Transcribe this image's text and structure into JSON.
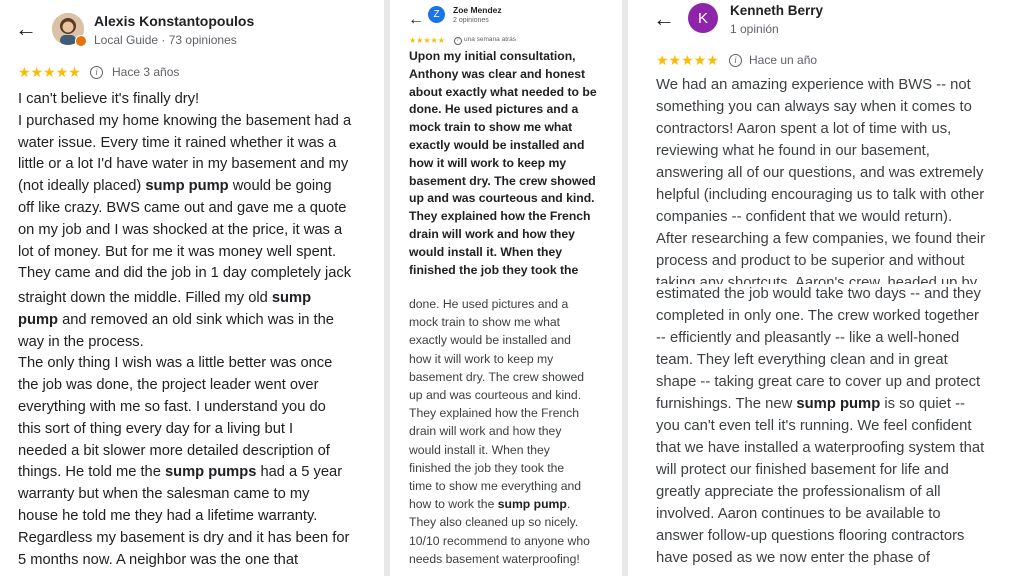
{
  "colors": {
    "star": "#fbbc04",
    "avatar_zoe": "#1a73e8",
    "avatar_kenneth": "#8e24aa",
    "text": "#202124",
    "muted": "#5f6368"
  },
  "icons": {
    "back": "arrow-left-icon",
    "info": "info-icon",
    "star": "star-icon"
  },
  "reviews": [
    {
      "author": "Alexis Konstantopoulos",
      "meta": "Local Guide · 73 opiniones",
      "rating": 5,
      "stars": "★★★★★",
      "ago": "Hace 3 años",
      "text_top": [
        "I can't believe it's finally dry!",
        "I purchased my home knowing the basement had a",
        "water issue. Every time it rained whether it was a",
        "little or a lot I'd have water in my basement and my",
        "(not ideally placed) |sump pump| would be going",
        "off like crazy. BWS came out and gave me a quote",
        "on my job and I was shocked at the price, it was a",
        "lot of money. But for me it was money well spent.",
        "They came and did the job in 1 day completely jack"
      ],
      "text_bottom": [
        "straight down the middle. Filled my old |sump|",
        "|pump| and removed an old sink which was in the",
        "way in the process.",
        "The only thing I wish was a little better was once",
        "the job was done, the project leader went over",
        "everything with me so fast. I understand you do",
        "this sort of thing every day for a living but I",
        "needed a bit slower more detailed description of",
        "things. He told me the |sump pumps| had a 5 year",
        "warranty but when the salesman came to my",
        "house he told me they had a lifetime warranty.",
        "Regardless my basement is dry and it has been for",
        "5 months now. A neighbor was the one that"
      ]
    },
    {
      "author": "Zoe Mendez",
      "initial": "Z",
      "meta": "2 opiniones",
      "rating": 5,
      "stars": "★★★★★",
      "ago": "una semana atrás",
      "text_top": [
        "Upon my initial consultation,",
        "Anthony was clear and honest",
        "about exactly what needed to be",
        "done. He used pictures and a",
        "mock train to show me what",
        "exactly would be installed and",
        "how it will work to keep my",
        "basement dry. The crew showed",
        "up and was courteous and kind.",
        "They explained how the French",
        "drain will work and how they",
        "would install it. When they",
        "finished the job they took the"
      ],
      "text_bottom": [
        "done. He used pictures and a",
        "mock train to show me what",
        "exactly would be installed and",
        "how it will work to keep my",
        "basement dry. The crew showed",
        "up and was courteous and kind.",
        "They explained how the French",
        "drain will work and how they",
        "would install it. When they",
        "finished the job they took the",
        "time to show me everything and",
        "how to work the |sump pump|.",
        "They also cleaned up so nicely.",
        "10/10 recommend to anyone who",
        "needs basement waterproofing!"
      ]
    },
    {
      "author": "Kenneth Berry",
      "initial": "K",
      "meta": "1 opinión",
      "rating": 5,
      "stars": "★★★★★",
      "ago": "Hace un año",
      "text_top": [
        "We had an amazing experience with BWS -- not",
        "something you can always say when it comes to",
        "contractors! Aaron spent a lot of time with us,",
        "reviewing what he found in our basement,",
        "answering all of our questions, and was extremely",
        "helpful (including encouraging us to talk with other",
        "companies -- confident that we would return).",
        "After researching a few companies, we found their",
        "process and product to be superior and without",
        "taking any shortcuts. Aaron's crew, headed up by"
      ],
      "text_bottom": [
        "estimated the job would take two days -- and they",
        "completed in only one. The crew worked together",
        "-- efficiently and pleasantly -- like a well-honed",
        "team. They left everything clean and in great",
        "shape -- taking great care to cover up and protect",
        "furnishings. The new |sump pump| is so quiet --",
        "you can't even tell it's running. We feel confident",
        "that we have installed a waterproofing system that",
        "will protect our finished basement for life and",
        "greatly appreciate the professionalism of all",
        "involved. Aaron continues to be available to",
        "answer follow-up questions flooring contractors",
        "have posed as we now enter the phase of"
      ]
    }
  ]
}
